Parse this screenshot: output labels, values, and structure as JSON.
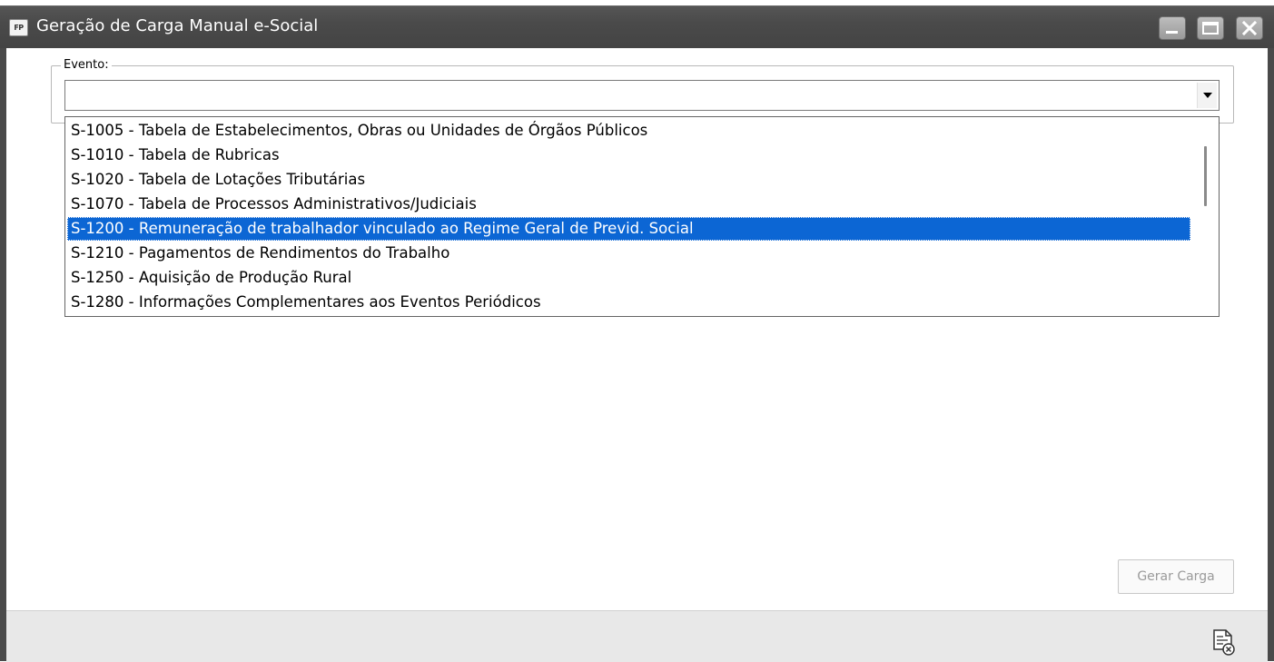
{
  "window": {
    "app_icon_text": "FP",
    "title": "Geração de Carga Manual e-Social"
  },
  "form": {
    "group_label": "Evento:",
    "combo_value": "",
    "dropdown_items": [
      "S-1005 - Tabela de Estabelecimentos, Obras ou Unidades de Órgãos Públicos",
      "S-1010 - Tabela de Rubricas",
      "S-1020 - Tabela de Lotações Tributárias",
      "S-1070 - Tabela de Processos Administrativos/Judiciais",
      "S-1200 - Remuneração de trabalhador vinculado ao Regime Geral de Previd. Social",
      "S-1210 - Pagamentos de Rendimentos do Trabalho",
      "S-1250 - Aquisição de Produção Rural",
      "S-1280 - Informações Complementares aos Eventos Periódicos"
    ],
    "selected_item": "S-1200 - Remuneração de trabalhador vinculado ao Regime Geral de Previd. Social"
  },
  "actions": {
    "gerar_label": "Gerar Carga"
  },
  "icons": {
    "app": "app-logo-icon",
    "minimize": "minimize-icon",
    "maximize": "maximize-icon",
    "close": "close-icon",
    "dropdown": "chevron-down-icon",
    "footer": "document-close-icon"
  },
  "colors": {
    "titlebar": "#4a4a4a",
    "selection": "#0c66d4",
    "footer": "#e8e8e8"
  }
}
